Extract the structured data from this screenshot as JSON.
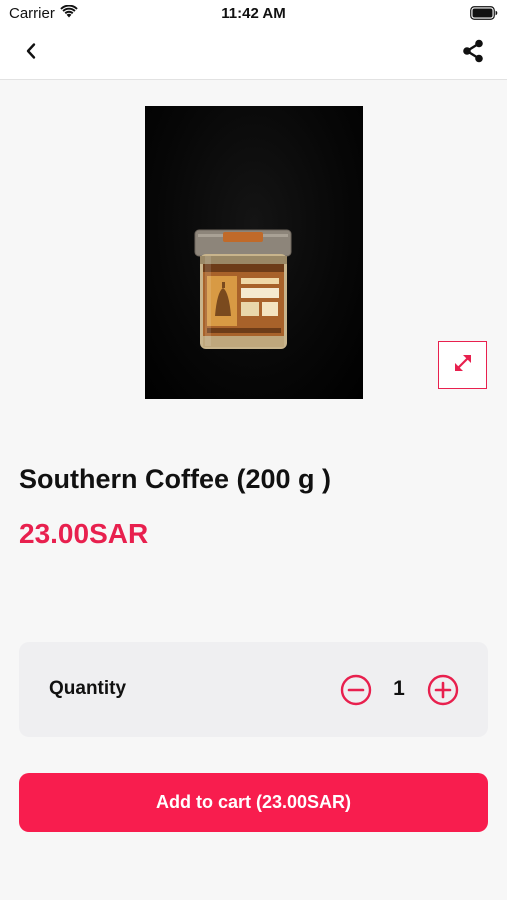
{
  "status_bar": {
    "carrier": "Carrier",
    "time": "11:42 AM",
    "wifi_icon": "wifi-icon",
    "battery_icon": "battery-icon"
  },
  "nav": {
    "back_icon": "chevron-left-icon",
    "share_icon": "share-icon"
  },
  "product": {
    "image_alt": "jar-photo",
    "expand_icon": "expand-arrows-icon",
    "title": "Southern Coffee (200 g )",
    "price": "23.00SAR"
  },
  "quantity": {
    "label": "Quantity",
    "value": "1",
    "minus_icon": "minus-circle-icon",
    "plus_icon": "plus-circle-icon"
  },
  "cart": {
    "button_label": "Add to cart (23.00SAR)"
  },
  "colors": {
    "accent": "#e8204e",
    "button": "#f81d4e",
    "background": "#f7f7f7",
    "card": "#efeff1"
  }
}
